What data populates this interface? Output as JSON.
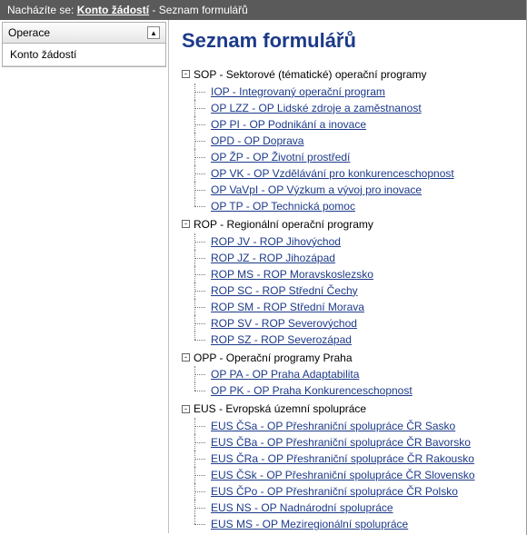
{
  "breadcrumb": {
    "prefix": "Nacházíte se:",
    "link": "Konto žádostí",
    "suffix": "- Seznam formulářů"
  },
  "sidebar": {
    "panel_title": "Operace",
    "items": [
      {
        "label": "Konto žádostí"
      }
    ]
  },
  "page_title": "Seznam formulářů",
  "tree": [
    {
      "label": "SOP - Sektorové (tématické) operační programy",
      "children": [
        {
          "label": "IOP - Integrovaný operační program"
        },
        {
          "label": "OP LZZ - OP Lidské zdroje a zaměstnanost"
        },
        {
          "label": "OP PI - OP Podnikání a inovace"
        },
        {
          "label": "OPD - OP Doprava"
        },
        {
          "label": "OP ŽP - OP Životní prostředí"
        },
        {
          "label": "OP VK - OP Vzdělávání pro konkurenceschopnost"
        },
        {
          "label": "OP VaVpI - OP Výzkum a vývoj pro inovace"
        },
        {
          "label": "OP TP - OP Technická pomoc"
        }
      ]
    },
    {
      "label": "ROP - Regionální operační programy",
      "children": [
        {
          "label": "ROP JV - ROP Jihovýchod"
        },
        {
          "label": "ROP JZ - ROP Jihozápad"
        },
        {
          "label": "ROP MS - ROP Moravskoslezsko"
        },
        {
          "label": "ROP SC - ROP Střední Čechy"
        },
        {
          "label": "ROP SM - ROP Střední Morava"
        },
        {
          "label": "ROP SV - ROP Severovýchod"
        },
        {
          "label": "ROP SZ - ROP Severozápad"
        }
      ]
    },
    {
      "label": "OPP - Operační programy Praha",
      "children": [
        {
          "label": "OP PA - OP Praha Adaptabilita"
        },
        {
          "label": "OP PK - OP Praha Konkurenceschopnost"
        }
      ]
    },
    {
      "label": "EUS - Evropská územní spolupráce",
      "children": [
        {
          "label": "EUS ČSa - OP Přeshraniční spolupráce ČR Sasko"
        },
        {
          "label": "EUS ČBa - OP Přeshraniční spolupráce ČR Bavorsko"
        },
        {
          "label": "EUS ČRa - OP Přeshraniční spolupráce ČR Rakousko"
        },
        {
          "label": "EUS ČSk - OP Přeshraniční spolupráce ČR Slovensko"
        },
        {
          "label": "EUS ČPo - OP Přeshraniční spolupráce ČR Polsko"
        },
        {
          "label": "EUS NS - OP Nadnárodní spolupráce"
        },
        {
          "label": "EUS MS - OP Meziregionální spolupráce"
        }
      ]
    }
  ]
}
